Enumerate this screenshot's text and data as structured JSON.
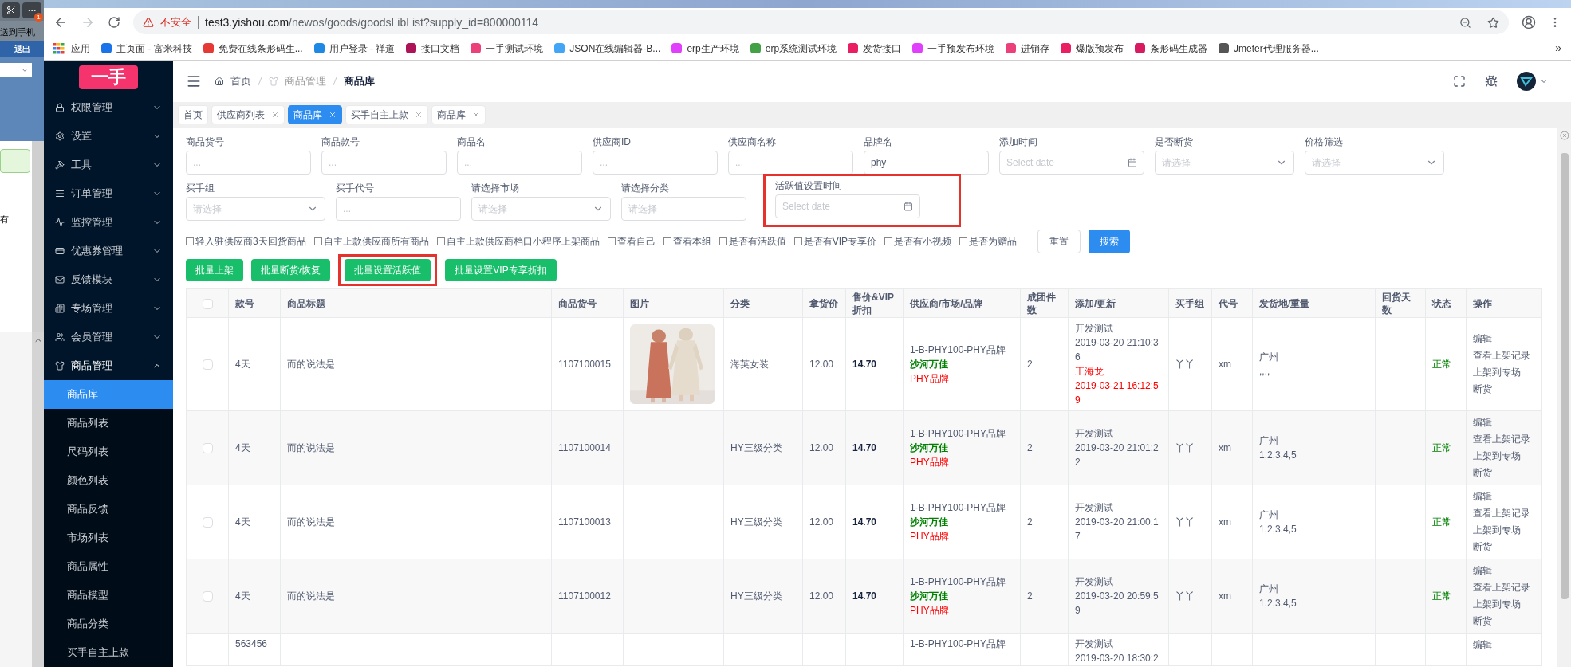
{
  "other_window": {
    "badge": "1",
    "send_label": "送到手机",
    "logout": "退出",
    "panel_text": "有"
  },
  "browser": {
    "security": "不安全",
    "url_host": "test3.yishou.com",
    "url_path": "/newos/goods/goodsLibList?supply_id=800000114",
    "apps_label": "应用",
    "bookmarks": [
      "主页面 - 富米科技",
      "免费在线条形码生...",
      "用户登录 - 禅道",
      "接口文档",
      "一手测试环境",
      "JSON在线编辑器-B...",
      "erp生产环境",
      "erp系统测试环境",
      "发货接口",
      "一手预发布环境",
      "进销存",
      "爆版预发布",
      "条形码生成器",
      "Jmeter代理服务器..."
    ],
    "more": "»"
  },
  "sidebar": {
    "logo": "一手",
    "menu": [
      {
        "label": "权限管理",
        "expanded": false
      },
      {
        "label": "设置",
        "expanded": false
      },
      {
        "label": "工具",
        "expanded": false
      },
      {
        "label": "订单管理",
        "expanded": false
      },
      {
        "label": "监控管理",
        "expanded": false
      },
      {
        "label": "优惠券管理",
        "expanded": false
      },
      {
        "label": "反馈模块",
        "expanded": false
      },
      {
        "label": "专场管理",
        "expanded": false
      },
      {
        "label": "会员管理",
        "expanded": false
      },
      {
        "label": "商品管理",
        "expanded": true,
        "children": [
          {
            "label": "商品库",
            "selected": true
          },
          {
            "label": "商品列表",
            "selected": false
          },
          {
            "label": "尺码列表",
            "selected": false
          },
          {
            "label": "颜色列表",
            "selected": false
          },
          {
            "label": "商品反馈",
            "selected": false
          },
          {
            "label": "市场列表",
            "selected": false
          },
          {
            "label": "商品属性",
            "selected": false
          },
          {
            "label": "商品模型",
            "selected": false
          },
          {
            "label": "商品分类",
            "selected": false
          },
          {
            "label": "买手自主上款",
            "selected": false
          }
        ]
      }
    ]
  },
  "breadcrumb": [
    "首页",
    "商品管理",
    "商品库"
  ],
  "tabs": [
    {
      "label": "首页",
      "selected": false,
      "closable": false
    },
    {
      "label": "供应商列表",
      "selected": false,
      "closable": true
    },
    {
      "label": "商品库",
      "selected": true,
      "closable": true
    },
    {
      "label": "买手自主上款",
      "selected": false,
      "closable": true
    },
    {
      "label": "商品库",
      "selected": false,
      "closable": true
    }
  ],
  "filters": {
    "rows": [
      [
        {
          "label": "商品货号",
          "kind": "text",
          "placeholder": "...",
          "highlighted": false
        },
        {
          "label": "商品款号",
          "kind": "text",
          "placeholder": "...",
          "highlighted": false
        },
        {
          "label": "商品名",
          "kind": "text",
          "placeholder": "...",
          "highlighted": false
        },
        {
          "label": "供应商ID",
          "kind": "text",
          "placeholder": "...",
          "highlighted": false
        },
        {
          "label": "供应商名称",
          "kind": "text",
          "placeholder": "...",
          "highlighted": false
        },
        {
          "label": "品牌名",
          "kind": "text",
          "value": "phy",
          "highlighted": false
        },
        {
          "label": "添加时间",
          "kind": "date",
          "placeholder": "Select date",
          "highlighted": false
        },
        {
          "label": "是否断货",
          "kind": "select",
          "placeholder": "请选择",
          "highlighted": false
        },
        {
          "label": "价格筛选",
          "kind": "select",
          "placeholder": "请选择",
          "highlighted": false
        }
      ],
      [
        {
          "label": "买手组",
          "kind": "select",
          "placeholder": "请选择",
          "highlighted": false
        },
        {
          "label": "买手代号",
          "kind": "text",
          "placeholder": "...",
          "highlighted": false
        },
        {
          "label": "请选择市场",
          "kind": "select",
          "placeholder": "请选择",
          "highlighted": false
        },
        {
          "label": "请选择分类",
          "kind": "text",
          "placeholder": "请选择",
          "highlighted": false
        },
        {
          "label": "活跃值设置时间",
          "kind": "date",
          "placeholder": "Select date",
          "highlighted": true
        }
      ]
    ],
    "checks": [
      {
        "label": "轻入驻供应商3天回货商品",
        "checked": false
      },
      {
        "label": "自主上款供应商所有商品",
        "checked": false
      },
      {
        "label": "自主上款供应商档口小程序上架商品",
        "checked": false
      },
      {
        "label": "查看自己",
        "checked": false
      },
      {
        "label": "查看本组",
        "checked": false
      },
      {
        "label": "是否有活跃值",
        "checked": false
      },
      {
        "label": "是否有VIP专享价",
        "checked": false
      },
      {
        "label": "是否有小视频",
        "checked": false
      },
      {
        "label": "是否为赠品",
        "checked": false
      }
    ],
    "reset": "重置",
    "search": "搜索"
  },
  "actions": [
    {
      "label": "批量上架",
      "highlighted": false
    },
    {
      "label": "批量断货/恢复",
      "highlighted": false
    },
    {
      "label": "批量设置活跃值",
      "highlighted": true
    },
    {
      "label": "批量设置VIP专享折扣",
      "highlighted": false
    }
  ],
  "table": {
    "header_selected": false,
    "columns": [
      "款号",
      "商品标题",
      "商品货号",
      "图片",
      "分类",
      "拿货价",
      "售价&VIP折扣",
      "供应商/市场/品牌",
      "成团件数",
      "添加/更新",
      "买手组",
      "代号",
      "发货地/重量",
      "回货天数",
      "状态",
      "操作"
    ],
    "rows": [
      {
        "selected": false,
        "style_no": "4天",
        "title": "而的说法是",
        "sku": "1107100015",
        "image": {
          "kind": "picture"
        },
        "category": "海英女装",
        "cost": "12.00",
        "price": "14.70",
        "supplier": "1-B-PHY100-PHY品牌",
        "market": "沙河万佳",
        "brand": "PHY品牌",
        "min_qty": "2",
        "created_by": "开发测试",
        "created_at": "2019-03-20 21:10:36",
        "updated_by": "王海龙",
        "updated_at": "2019-03-21 16:12:59",
        "buyer_group": "丫丫",
        "code": "xm",
        "origin": "广州",
        "weight": ",,,,",
        "status": "正常",
        "actions": [
          "编辑",
          "查看上架记录",
          "上架到专场",
          "断货"
        ]
      },
      {
        "selected": false,
        "style_no": "4天",
        "title": "而的说法是",
        "sku": "1107100014",
        "category": "HY三级分类",
        "cost": "12.00",
        "price": "14.70",
        "supplier": "1-B-PHY100-PHY品牌",
        "market": "沙河万佳",
        "brand": "PHY品牌",
        "min_qty": "2",
        "created_by": "开发测试",
        "created_at": "2019-03-20 21:01:22",
        "buyer_group": "丫丫",
        "code": "xm",
        "origin": "广州",
        "weight": "1,2,3,4,5",
        "status": "正常",
        "actions": [
          "编辑",
          "查看上架记录",
          "上架到专场",
          "断货"
        ]
      },
      {
        "selected": false,
        "style_no": "4天",
        "title": "而的说法是",
        "sku": "1107100013",
        "category": "HY三级分类",
        "cost": "12.00",
        "price": "14.70",
        "supplier": "1-B-PHY100-PHY品牌",
        "market": "沙河万佳",
        "brand": "PHY品牌",
        "min_qty": "2",
        "created_by": "开发测试",
        "created_at": "2019-03-20 21:00:17",
        "buyer_group": "丫丫",
        "code": "xm",
        "origin": "广州",
        "weight": "1,2,3,4,5",
        "status": "正常",
        "actions": [
          "编辑",
          "查看上架记录",
          "上架到专场",
          "断货"
        ]
      },
      {
        "selected": false,
        "style_no": "4天",
        "title": "而的说法是",
        "sku": "1107100012",
        "category": "HY三级分类",
        "cost": "12.00",
        "price": "14.70",
        "supplier": "1-B-PHY100-PHY品牌",
        "market": "沙河万佳",
        "brand": "PHY品牌",
        "min_qty": "2",
        "created_by": "开发测试",
        "created_at": "2019-03-20 20:59:59",
        "buyer_group": "丫丫",
        "code": "xm",
        "origin": "广州",
        "weight": "1,2,3,4,5",
        "status": "正常",
        "actions": [
          "编辑",
          "查看上架记录",
          "上架到专场",
          "断货"
        ]
      },
      {
        "style_no": "563456",
        "supplier": "1-B-PHY100-PHY品牌",
        "created_by": "开发测试",
        "created_at": "2019-03-20 18:30:2",
        "actions": [
          "编辑"
        ]
      }
    ]
  }
}
